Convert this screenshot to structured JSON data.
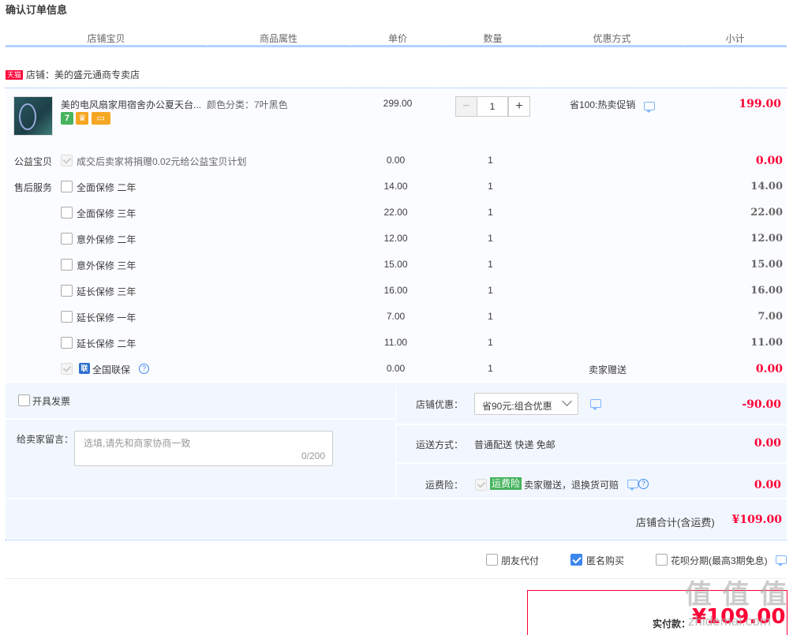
{
  "page": {
    "title": "确认订单信息"
  },
  "columns": [
    "店铺宝贝",
    "商品属性",
    "单价",
    "数量",
    "优惠方式",
    "小计"
  ],
  "shop": {
    "badge": "天猫",
    "label": "店铺：美的盛元通商专卖店"
  },
  "item": {
    "name": "美的电风扇家用宿舍办公夏天台...",
    "attr": "颜色分类：7叶黑色",
    "unit_price": "299.00",
    "quantity": "1",
    "discount": "省100:热卖促销",
    "subtotal": "199.00",
    "badge_icons": [
      "seven-day-return-icon",
      "shop-guarantee-icon",
      "credit-card-icon"
    ]
  },
  "charity": {
    "label": "公益宝贝",
    "text": "成交后卖家将捐赠0.02元给公益宝贝计划",
    "price": "0.00",
    "qty": "1",
    "subtotal": "0.00"
  },
  "services": {
    "label": "售后服务",
    "rows": [
      {
        "name": "全面保修 二年",
        "price": "14.00",
        "qty": "1",
        "subtotal": "14.00"
      },
      {
        "name": "全面保修 三年",
        "price": "22.00",
        "qty": "1",
        "subtotal": "22.00"
      },
      {
        "name": "意外保修 二年",
        "price": "12.00",
        "qty": "1",
        "subtotal": "12.00"
      },
      {
        "name": "意外保修 三年",
        "price": "15.00",
        "qty": "1",
        "subtotal": "15.00"
      },
      {
        "name": "延长保修 三年",
        "price": "16.00",
        "qty": "1",
        "subtotal": "16.00"
      },
      {
        "name": "延长保修 一年",
        "price": "7.00",
        "qty": "1",
        "subtotal": "7.00"
      },
      {
        "name": "延长保修 二年",
        "price": "11.00",
        "qty": "1",
        "subtotal": "11.00"
      }
    ],
    "national": {
      "icon_text": "联",
      "name": "全国联保",
      "price": "0.00",
      "qty": "1",
      "discount": "卖家赠送",
      "subtotal": "0.00"
    }
  },
  "invoice": {
    "label": "开具发票"
  },
  "message": {
    "label": "给卖家留言：",
    "placeholder": "选填,请先和商家协商一致",
    "counter": "0/200"
  },
  "shop_discount": {
    "label": "店铺优惠：",
    "selected": "省90元:组合优惠",
    "amount": "-90.00"
  },
  "shipping": {
    "label": "运送方式：",
    "value": "普通配送 快递 免邮",
    "amount": "0.00"
  },
  "insurance": {
    "label": "运费险：",
    "badge": "运费险",
    "text": "卖家赠送，退换货可赔",
    "amount": "0.00"
  },
  "shop_total": {
    "label": "店铺合计(含运费)",
    "amount": "¥109.00"
  },
  "options": {
    "friend_pay": "朋友代付",
    "anonymous": "匿名购买",
    "huabei": "花呗分期(最高3期免息)"
  },
  "payment": {
    "label": "实付款：",
    "amount": "¥109.00"
  },
  "watermark": {
    "text": "值 值 值",
    "site": "zhidemai.com"
  },
  "colors": {
    "accent_red": "#ff0036",
    "header_line": "#b2d1ff",
    "link_blue": "#3c86f0"
  }
}
